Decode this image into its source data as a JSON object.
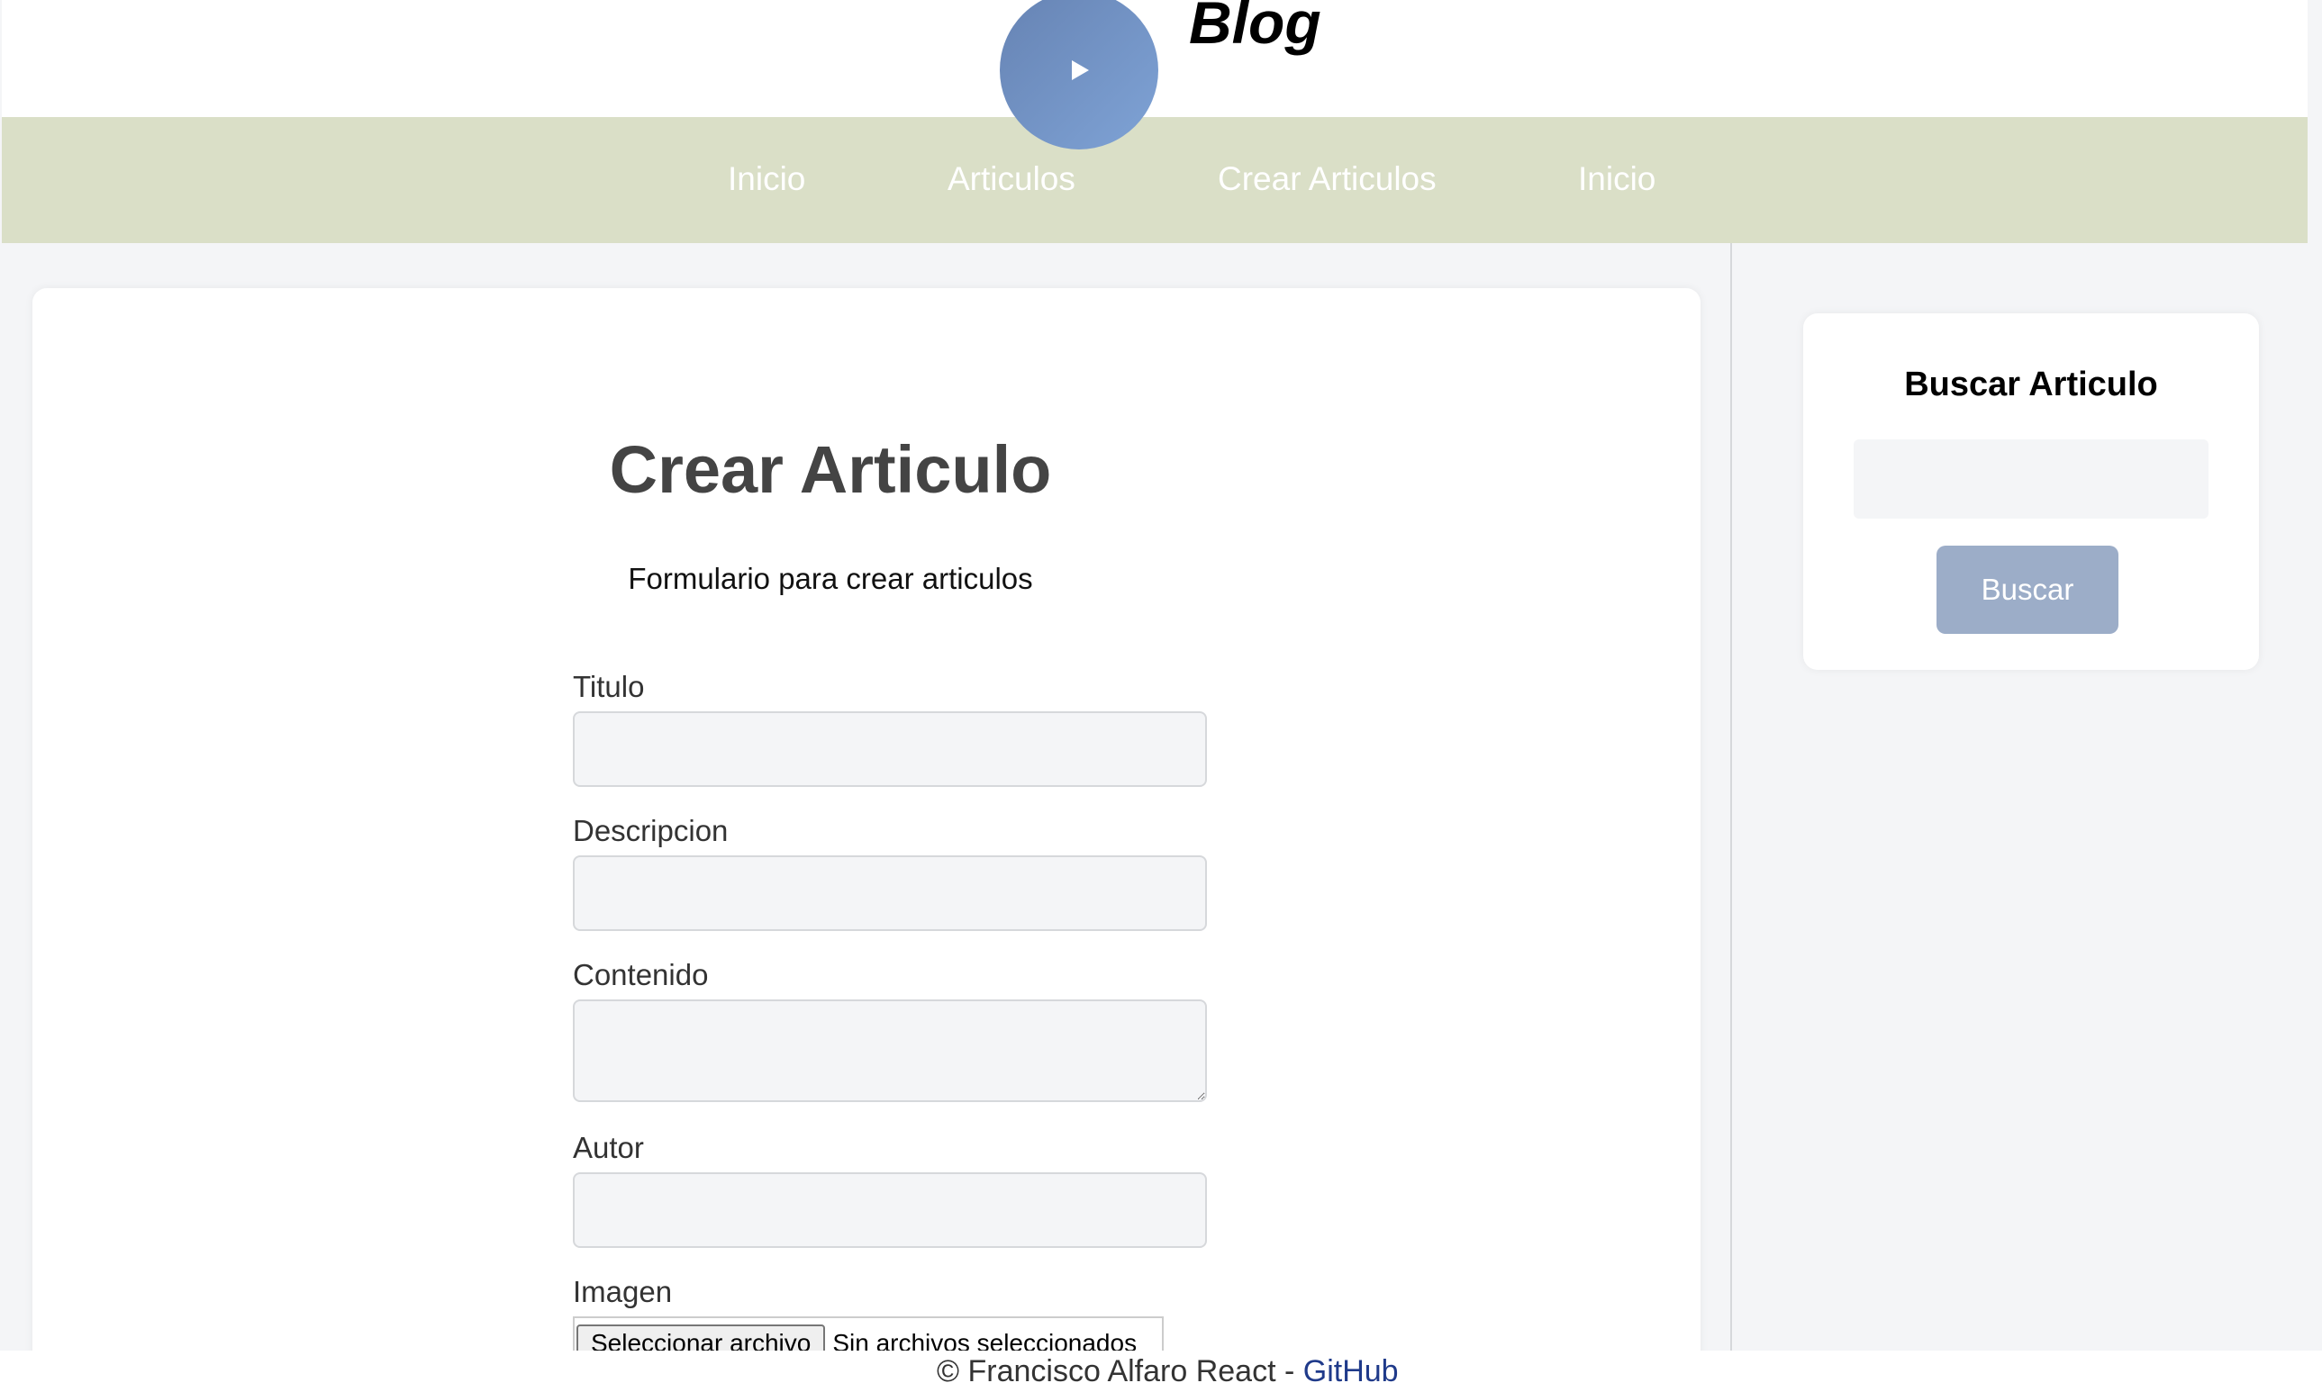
{
  "header": {
    "site_title": "Blog",
    "logo_icon": "play-icon"
  },
  "nav": {
    "items": [
      {
        "label": "Inicio"
      },
      {
        "label": "Articulos"
      },
      {
        "label": "Crear Articulos"
      },
      {
        "label": "Inicio"
      }
    ]
  },
  "main": {
    "title": "Crear Articulo",
    "subtitle": "Formulario para crear articulos",
    "fields": {
      "titulo": {
        "label": "Titulo",
        "value": ""
      },
      "descripcion": {
        "label": "Descripcion",
        "value": ""
      },
      "contenido": {
        "label": "Contenido",
        "value": ""
      },
      "autor": {
        "label": "Autor",
        "value": ""
      },
      "imagen": {
        "label": "Imagen",
        "button_label": "Seleccionar archivo",
        "status": "Sin archivos seleccionados"
      }
    }
  },
  "sidebar": {
    "title": "Buscar Articulo",
    "search_value": "",
    "button_label": "Buscar"
  },
  "footer": {
    "text": "© Francisco Alfaro React - ",
    "link_label": "GitHub"
  },
  "colors": {
    "nav_background": "#dadfc7",
    "logo_gradient_start": "#6683b3",
    "logo_gradient_end": "#7fa3d6",
    "search_button": "#9cadc8",
    "footer_link": "#1f3a8a",
    "page_background": "#f4f5f7"
  }
}
